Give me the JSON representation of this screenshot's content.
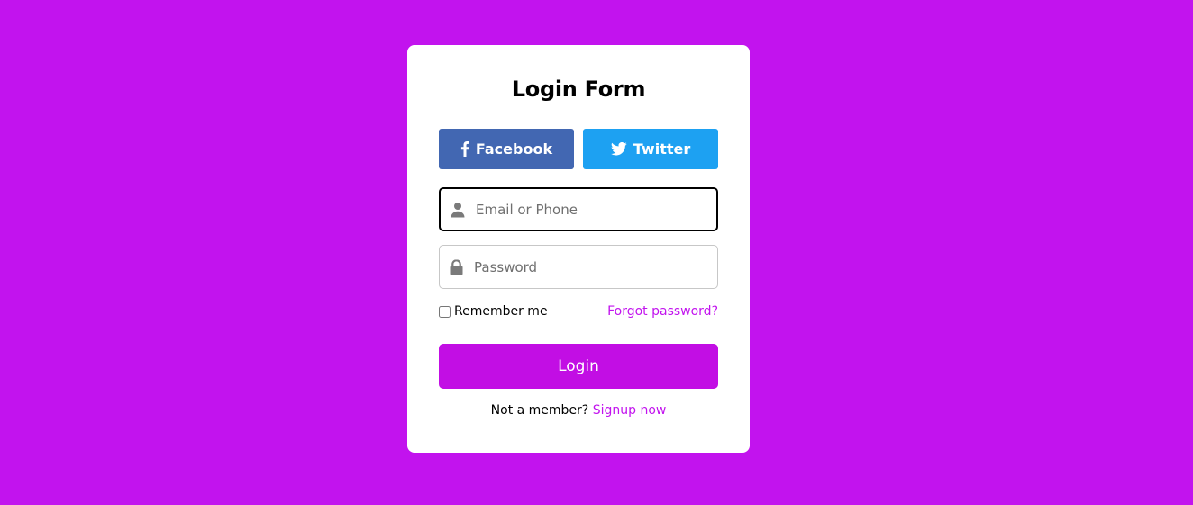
{
  "colors": {
    "background": "#c213ee",
    "card": "#ffffff",
    "facebook": "#4267b2",
    "twitter": "#1da1f2",
    "accent": "#c20ee4"
  },
  "form": {
    "title": "Login Form",
    "social": {
      "facebook_label": "Facebook",
      "facebook_icon": "facebook-icon",
      "twitter_label": "Twitter",
      "twitter_icon": "twitter-icon"
    },
    "email": {
      "placeholder": "Email or Phone",
      "value": "",
      "icon": "user-icon"
    },
    "password": {
      "placeholder": "Password",
      "value": "",
      "icon": "lock-icon"
    },
    "remember_label": "Remember me",
    "remember_checked": false,
    "forgot_label": "Forgot password?",
    "login_label": "Login",
    "signup_prompt": "Not a member?",
    "signup_link": "Signup now"
  }
}
